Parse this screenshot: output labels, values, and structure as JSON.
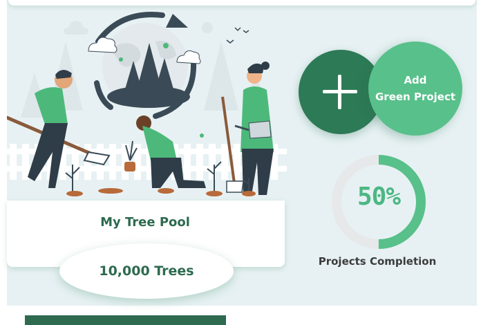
{
  "header": {},
  "tree_pool": {
    "title": "My Tree Pool",
    "trees_count": "10,000 Trees"
  },
  "add_project": {
    "line1": "Add",
    "line2": "Green Project",
    "plus_icon": "plus-icon"
  },
  "projects_completion": {
    "percent_label": "50%",
    "fraction": 0.5,
    "label": "Projects Completion"
  },
  "colors": {
    "dark_green": "#2d6a4f",
    "accent_green": "#58c08a",
    "panel_bg": "#e7f1f3",
    "ring_track": "#e6e8ea"
  }
}
